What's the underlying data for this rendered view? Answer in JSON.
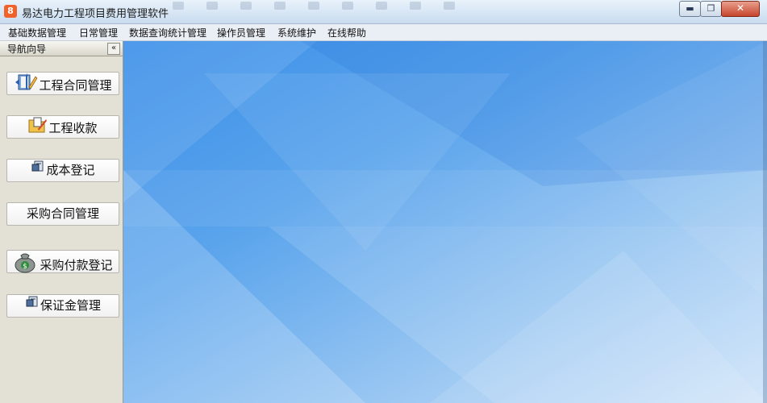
{
  "window": {
    "title": "易达电力工程项目费用管理软件",
    "icon_glyph": "8",
    "minimize_glyph": "▬",
    "maximize_glyph": "❐",
    "close_glyph": "✕"
  },
  "menu": [
    "基础数据管理",
    "日常管理",
    "数据查询统计管理",
    "操作员管理",
    "系统维护",
    "在线帮助"
  ],
  "nav": {
    "title": "导航向导",
    "collapse_glyph": "«",
    "buttons": [
      {
        "label": "工程合同管理",
        "icon": "contract-book-icon"
      },
      {
        "label": "工程收款",
        "icon": "folder-edit-icon"
      },
      {
        "label": "成本登记",
        "icon": "cost-register-icon"
      },
      {
        "label": "采购合同管理",
        "icon": ""
      },
      {
        "label": "采购付款登记",
        "icon": "money-bag-icon"
      },
      {
        "label": "保证金管理",
        "icon": "deposit-register-icon"
      }
    ]
  }
}
